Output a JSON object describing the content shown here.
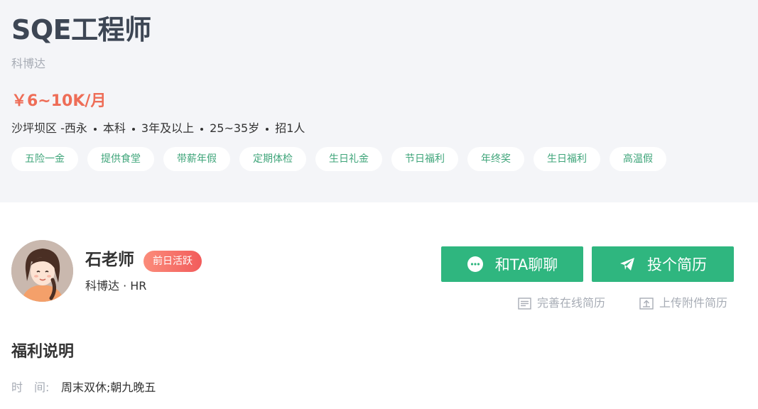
{
  "job": {
    "title": "SQE工程师",
    "company": "科博达",
    "salary": "￥6~10K/月",
    "meta": [
      "沙坪坝区 -西永",
      "本科",
      "3年及以上",
      "25~35岁",
      "招1人"
    ],
    "tags": [
      "五险一金",
      "提供食堂",
      "带薪年假",
      "定期体检",
      "生日礼金",
      "节日福利",
      "年终奖",
      "生日福利",
      "高温假"
    ]
  },
  "recruiter": {
    "name": "石老师",
    "active_badge": "前日活跃",
    "info": "科博达 · HR"
  },
  "actions": {
    "chat_label": "和TA聊聊",
    "apply_label": "投个简历",
    "edit_resume_label": "完善在线简历",
    "upload_resume_label": "上传附件简历"
  },
  "welfare": {
    "title": "福利说明",
    "time_label": "时　间:",
    "time_value": "周末双休;朝九晚五"
  },
  "colors": {
    "accent_green": "#2fb67f",
    "salary_red": "#ee6d57",
    "tag_green": "#3fa57a",
    "header_bg": "#f4f5f8"
  }
}
